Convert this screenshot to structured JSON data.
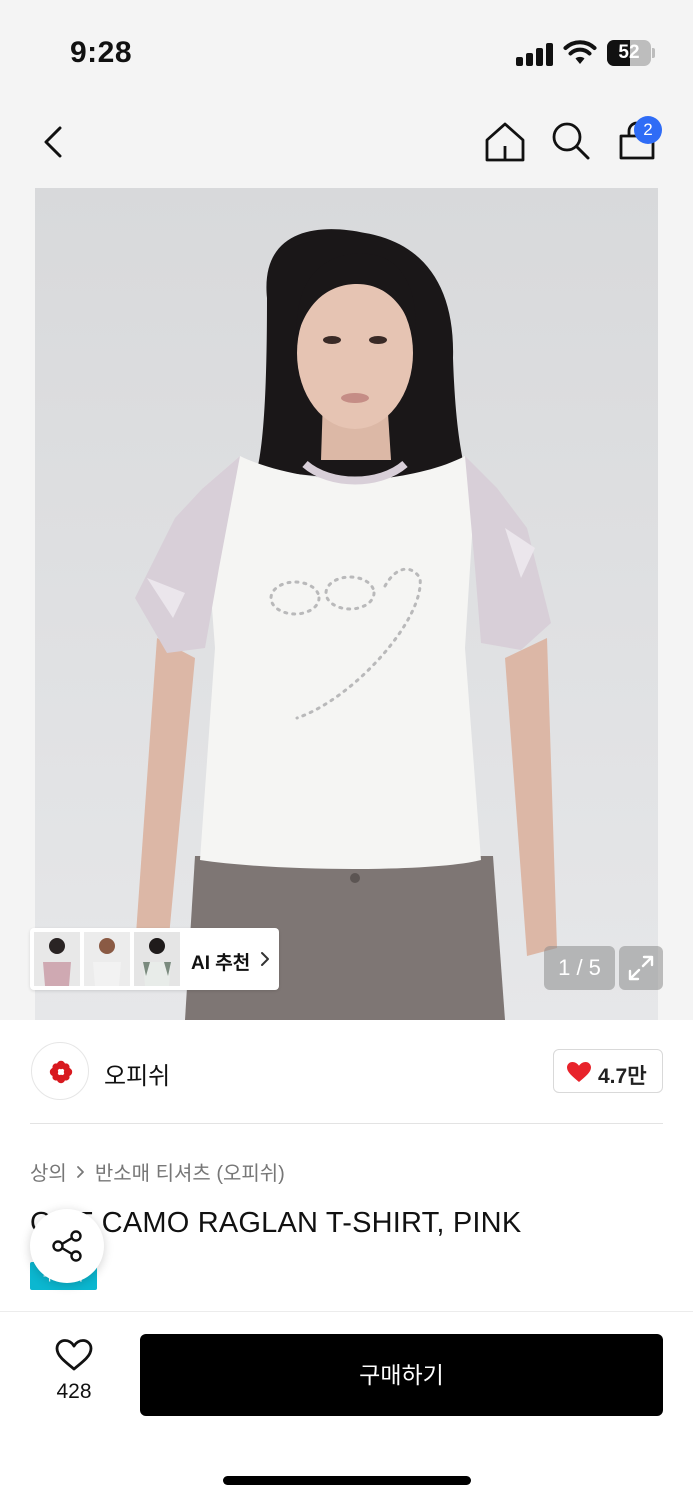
{
  "status_bar": {
    "time": "9:28",
    "battery": "52",
    "battery_level": 0.52
  },
  "nav": {
    "cart_count": "2",
    "icons": [
      "chevron-left-icon",
      "home-icon",
      "search-icon",
      "shopping-bag-icon"
    ]
  },
  "gallery": {
    "ai_label": "AI 추천",
    "counter": "1 / 5",
    "expand_icon": "expand-icon",
    "thumbnails": [
      {
        "top_color": "#cfa9b2"
      },
      {
        "top_color": "#f2f2f2"
      },
      {
        "top_color": "#e8ece9"
      }
    ]
  },
  "brand": {
    "name": "오피쉬",
    "likes": "4.7만",
    "heart_color": "#e8232b"
  },
  "product": {
    "breadcrumb": [
      "상의",
      "반소매 티셔츠 (오피쉬)"
    ],
    "title": "OGF CAMO RAGLAN T-SHIRT, PINK",
    "badge": "무신사",
    "badge_color": "#0bb7d0"
  },
  "bottom": {
    "wish_count": "428",
    "buy_label": "구매하기"
  }
}
